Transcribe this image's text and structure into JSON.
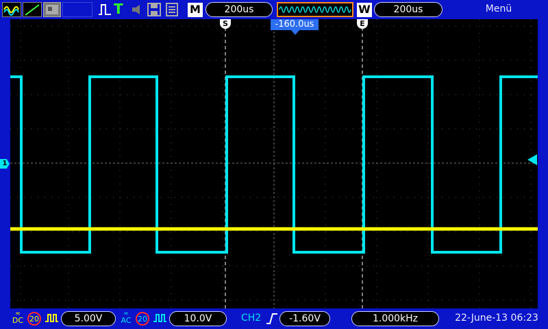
{
  "toolbar": {
    "timebase_value": "200us",
    "mode_label": "M",
    "window_label": "W",
    "window_value": "200us",
    "menu_label": "Menü",
    "trigger_type_label": "T"
  },
  "screen": {
    "trigger_offset": "-160.0us",
    "cursor_start_label": "S",
    "cursor_end_label": "E",
    "ch1_marker": "1"
  },
  "bottom": {
    "ch1_coupling": "DC",
    "ch1_bw_limit": "20",
    "ch1_volts_div": "5.00V",
    "ch2_coupling": "AC",
    "ch2_bw_limit": "20",
    "ch2_volts_div": "10.0V",
    "trigger_source": "CH2",
    "trigger_level": "-1.60V",
    "frequency": "1.000kHz",
    "datetime": "22-June-13 06:23"
  },
  "colors": {
    "ch1": "#ffff00",
    "ch2": "#00e5ee",
    "background": "#0a14c8"
  }
}
